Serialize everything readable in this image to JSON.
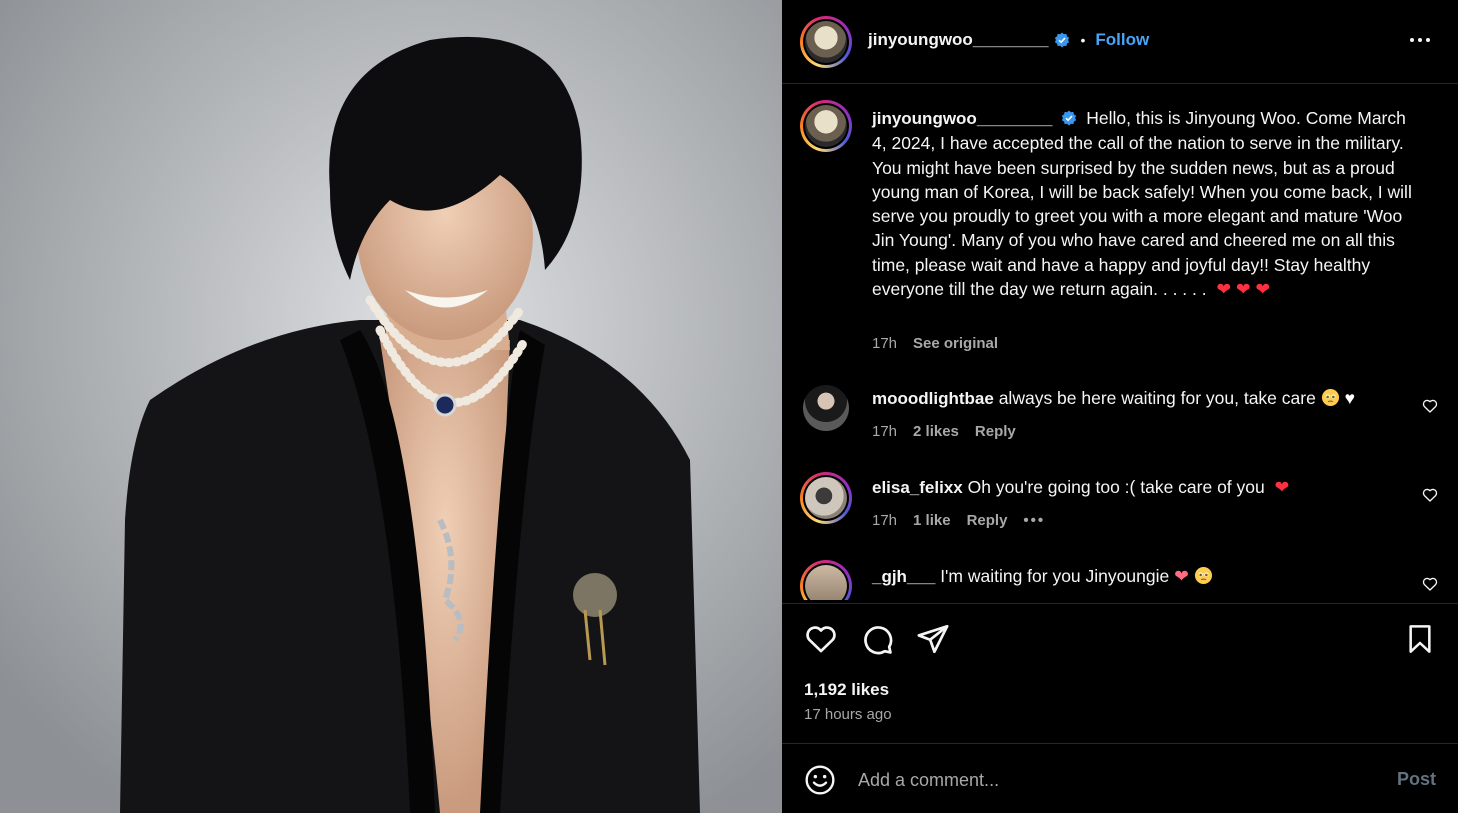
{
  "post": {
    "username": "jinyoungwoo________",
    "follow_label": "Follow",
    "separator": "•",
    "caption": "Hello, this is Jinyoung Woo. Come March 4, 2024, I have accepted the call of the nation to serve in the military. You might have been surprised by the sudden news, but as a proud young man of Korea, I will be back safely! When you come back, I will serve you proudly to greet you with a more elegant and mature 'Woo Jin Young'. Many of you who have cared and cheered me on all this time, please wait and have a happy and joyful day!! Stay healthy everyone till the day we return again. . . . . .",
    "caption_time": "17h",
    "see_original": "See original",
    "likes": "1,192 likes",
    "posted_ago": "17 hours ago"
  },
  "comments": [
    {
      "username": "mooodlightbae",
      "text": "always be here waiting for you, take care",
      "time": "17h",
      "likes": "2 likes",
      "reply": "Reply"
    },
    {
      "username": "elisa_felixx",
      "text": "Oh you're going too :( take care of you",
      "time": "17h",
      "likes": "1 like",
      "reply": "Reply"
    },
    {
      "username": "_gjh___",
      "text": "I'm waiting for you Jinyoungie"
    }
  ],
  "composer": {
    "placeholder": "Add a comment...",
    "post_label": "Post"
  },
  "colors": {
    "accent": "#4aa3f5",
    "heart_red": "#ff3040",
    "muted_text": "#a8a8a8",
    "background": "#000000"
  },
  "icons": [
    "more-icon",
    "verified-icon",
    "heart-icon",
    "comment-icon",
    "share-icon",
    "bookmark-icon",
    "emoji-icon"
  ]
}
